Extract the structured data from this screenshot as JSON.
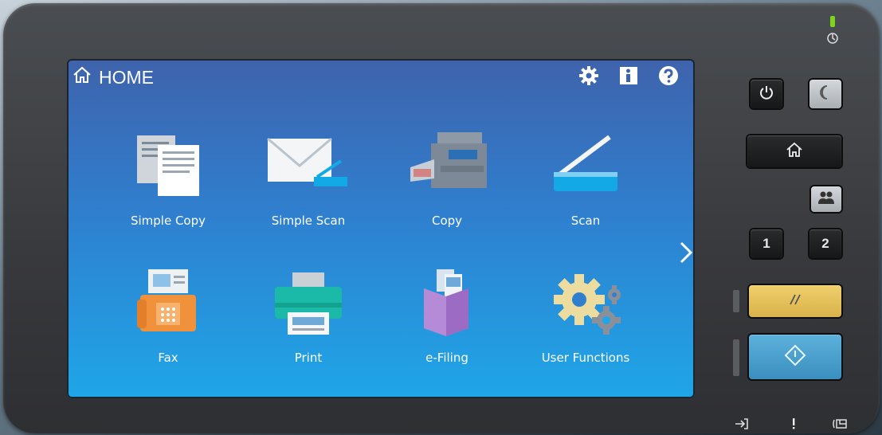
{
  "screen": {
    "title": "HOME",
    "top_icons": [
      "gear-icon",
      "info-icon",
      "help-icon"
    ]
  },
  "tiles": [
    {
      "label": "Simple Copy",
      "icon": "simple-copy-icon"
    },
    {
      "label": "Simple Scan",
      "icon": "simple-scan-icon"
    },
    {
      "label": "Copy",
      "icon": "copy-icon"
    },
    {
      "label": "Scan",
      "icon": "scan-icon"
    },
    {
      "label": "Fax",
      "icon": "fax-icon"
    },
    {
      "label": "Print",
      "icon": "print-icon"
    },
    {
      "label": "e-Filing",
      "icon": "e-filing-icon"
    },
    {
      "label": "User Functions",
      "icon": "user-functions-icon"
    }
  ],
  "hardware": {
    "job_keys": [
      "1",
      "2"
    ],
    "colors": {
      "reset": "#e6c35a",
      "start": "#4aa3cf",
      "screen_top": "#3f63ac",
      "screen_bottom": "#1fa6e8"
    }
  }
}
